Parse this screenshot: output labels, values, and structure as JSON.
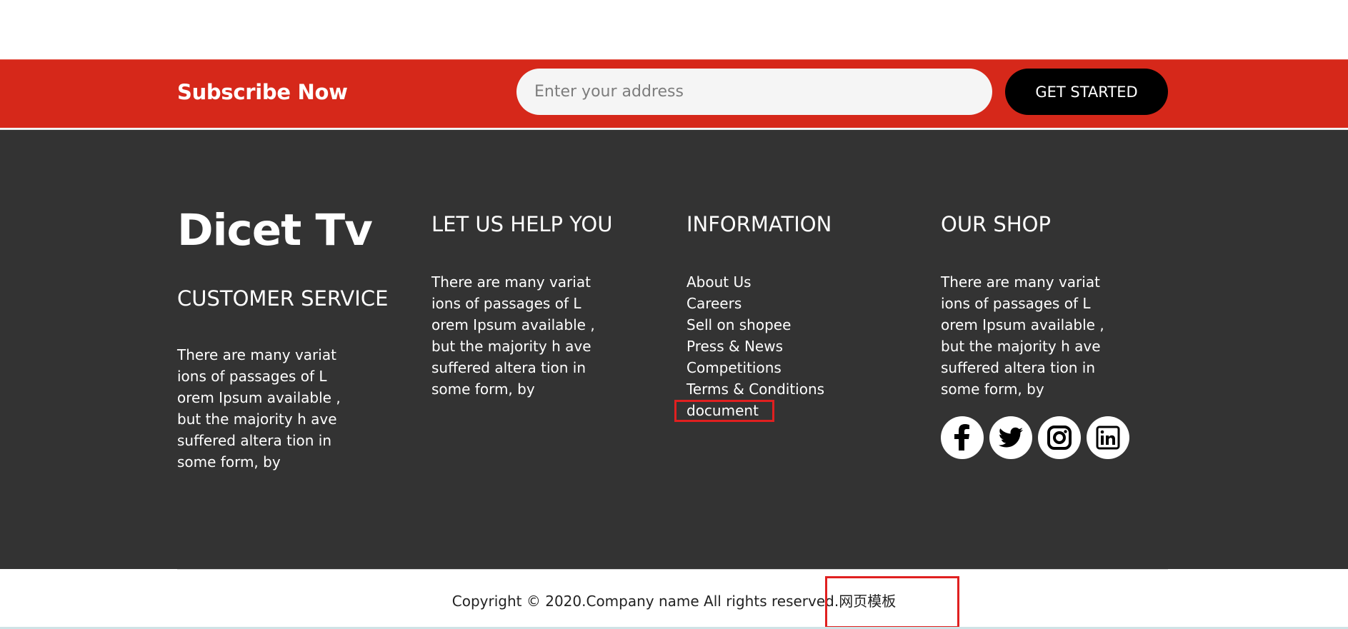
{
  "subscribe": {
    "title": "Subscribe Now",
    "input_placeholder": "Enter your address",
    "button_label": "GET STARTED"
  },
  "footer": {
    "brand": {
      "logo": "Dicet Tv",
      "heading": "CUSTOMER SERVICE",
      "text": "There are many variat\nions of passages of L\norem Ipsum available ,\nbut the majority h ave\nsuffered altera tion in\nsome form, by"
    },
    "help": {
      "heading": "LET US HELP YOU",
      "text": "There are many variat\nions of passages of L\norem Ipsum available ,\nbut the majority h ave\nsuffered altera tion in\nsome form, by"
    },
    "information": {
      "heading": "INFORMATION",
      "links": [
        "About Us",
        "Careers",
        "Sell on shopee",
        "Press & News",
        "Competitions",
        "Terms & Conditions",
        "document"
      ]
    },
    "shop": {
      "heading": "OUR SHOP",
      "text": "There are many variat\nions of passages of L\norem Ipsum available ,\nbut the majority h ave\nsuffered altera tion in\nsome form, by",
      "socials": [
        "facebook-icon",
        "twitter-icon",
        "instagram-icon",
        "linkedin-icon"
      ]
    }
  },
  "copyright": {
    "text": "Copyright © 2020.Company name All rights reserved.",
    "link": "网页模板"
  },
  "colors": {
    "accent_red": "#d6281a",
    "footer_bg": "#333333",
    "button_bg": "#000000",
    "highlight_box": "#e02020"
  }
}
